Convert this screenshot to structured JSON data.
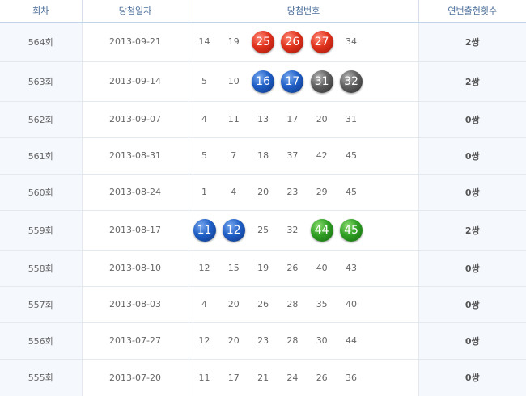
{
  "headers": {
    "round": "회차",
    "date": "당첨일자",
    "numbers": "당첨번호",
    "consecutive": "연번출현횟수"
  },
  "colors": {
    "red": "#e0321c",
    "blue": "#1f5fc6",
    "gray": "#5f5f5f",
    "green": "#2f9e24"
  },
  "rows": [
    {
      "round": "564회",
      "date": "2013-09-21",
      "count": "2쌍",
      "height": 49,
      "numbers": [
        {
          "v": "14",
          "c": ""
        },
        {
          "v": "19",
          "c": ""
        },
        {
          "v": "25",
          "c": "red"
        },
        {
          "v": "26",
          "c": "red"
        },
        {
          "v": "27",
          "c": "red"
        },
        {
          "v": "34",
          "c": ""
        }
      ]
    },
    {
      "round": "563회",
      "date": "2013-09-14",
      "count": "2쌍",
      "height": 49,
      "numbers": [
        {
          "v": "5",
          "c": ""
        },
        {
          "v": "10",
          "c": ""
        },
        {
          "v": "16",
          "c": "blue"
        },
        {
          "v": "17",
          "c": "blue"
        },
        {
          "v": "31",
          "c": "gray"
        },
        {
          "v": "32",
          "c": "gray"
        }
      ]
    },
    {
      "round": "562회",
      "date": "2013-09-07",
      "count": "0쌍",
      "height": 45,
      "numbers": [
        {
          "v": "4",
          "c": ""
        },
        {
          "v": "11",
          "c": ""
        },
        {
          "v": "13",
          "c": ""
        },
        {
          "v": "17",
          "c": ""
        },
        {
          "v": "20",
          "c": ""
        },
        {
          "v": "31",
          "c": ""
        }
      ]
    },
    {
      "round": "561회",
      "date": "2013-08-31",
      "count": "0쌍",
      "height": 45,
      "numbers": [
        {
          "v": "5",
          "c": ""
        },
        {
          "v": "7",
          "c": ""
        },
        {
          "v": "18",
          "c": ""
        },
        {
          "v": "37",
          "c": ""
        },
        {
          "v": "42",
          "c": ""
        },
        {
          "v": "45",
          "c": ""
        }
      ]
    },
    {
      "round": "560회",
      "date": "2013-08-24",
      "count": "0쌍",
      "height": 45,
      "numbers": [
        {
          "v": "1",
          "c": ""
        },
        {
          "v": "4",
          "c": ""
        },
        {
          "v": "20",
          "c": ""
        },
        {
          "v": "23",
          "c": ""
        },
        {
          "v": "29",
          "c": ""
        },
        {
          "v": "45",
          "c": ""
        }
      ]
    },
    {
      "round": "559회",
      "date": "2013-08-17",
      "count": "2쌍",
      "height": 49,
      "numbers": [
        {
          "v": "11",
          "c": "blue"
        },
        {
          "v": "12",
          "c": "blue"
        },
        {
          "v": "25",
          "c": ""
        },
        {
          "v": "32",
          "c": ""
        },
        {
          "v": "44",
          "c": "green"
        },
        {
          "v": "45",
          "c": "green"
        }
      ]
    },
    {
      "round": "558회",
      "date": "2013-08-10",
      "count": "0쌍",
      "height": 45,
      "numbers": [
        {
          "v": "12",
          "c": ""
        },
        {
          "v": "15",
          "c": ""
        },
        {
          "v": "19",
          "c": ""
        },
        {
          "v": "26",
          "c": ""
        },
        {
          "v": "40",
          "c": ""
        },
        {
          "v": "43",
          "c": ""
        }
      ]
    },
    {
      "round": "557회",
      "date": "2013-08-03",
      "count": "0쌍",
      "height": 45,
      "numbers": [
        {
          "v": "4",
          "c": ""
        },
        {
          "v": "20",
          "c": ""
        },
        {
          "v": "26",
          "c": ""
        },
        {
          "v": "28",
          "c": ""
        },
        {
          "v": "35",
          "c": ""
        },
        {
          "v": "40",
          "c": ""
        }
      ]
    },
    {
      "round": "556회",
      "date": "2013-07-27",
      "count": "0쌍",
      "height": 45,
      "numbers": [
        {
          "v": "12",
          "c": ""
        },
        {
          "v": "20",
          "c": ""
        },
        {
          "v": "23",
          "c": ""
        },
        {
          "v": "28",
          "c": ""
        },
        {
          "v": "30",
          "c": ""
        },
        {
          "v": "44",
          "c": ""
        }
      ]
    },
    {
      "round": "555회",
      "date": "2013-07-20",
      "count": "0쌍",
      "height": 46,
      "numbers": [
        {
          "v": "11",
          "c": ""
        },
        {
          "v": "17",
          "c": ""
        },
        {
          "v": "21",
          "c": ""
        },
        {
          "v": "24",
          "c": ""
        },
        {
          "v": "26",
          "c": ""
        },
        {
          "v": "36",
          "c": ""
        }
      ]
    }
  ]
}
